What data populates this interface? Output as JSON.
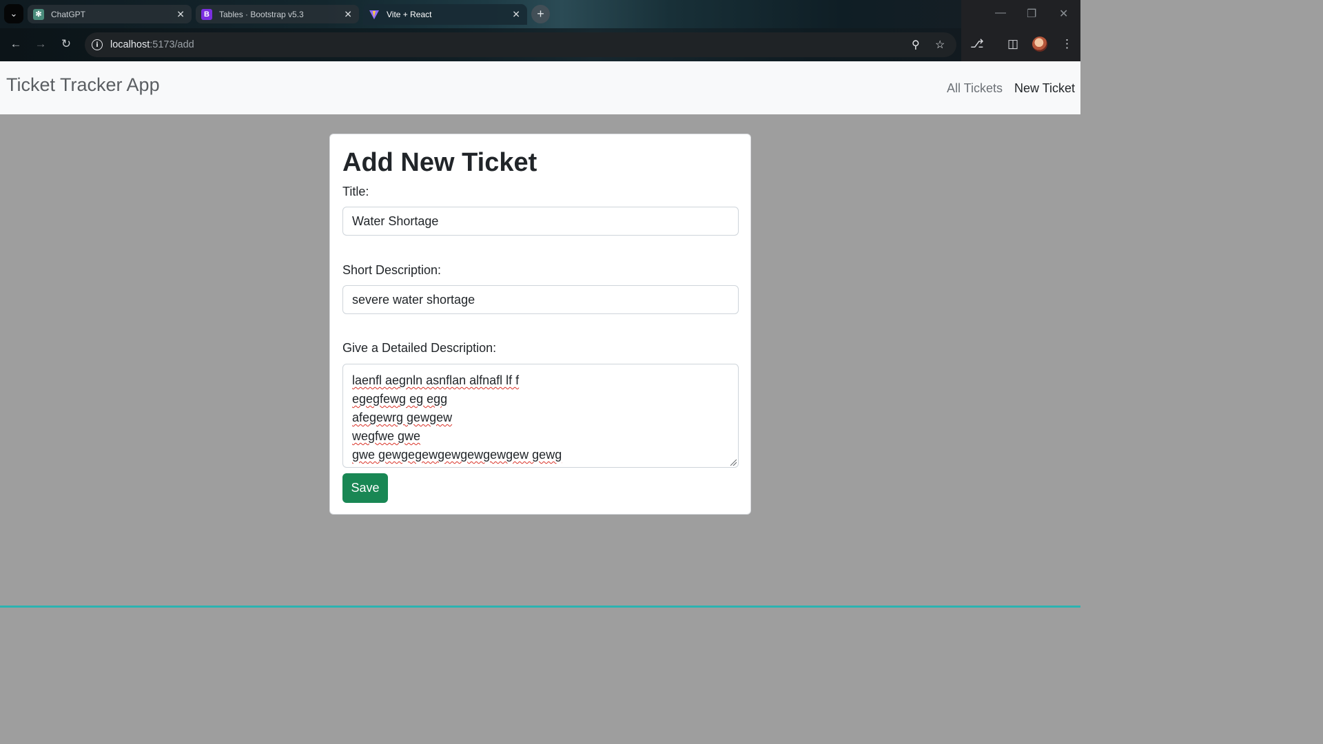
{
  "browser": {
    "tabs": [
      {
        "title": "ChatGPT",
        "icon": "chatgpt-icon",
        "active": false
      },
      {
        "title": "Tables · Bootstrap v5.3",
        "icon": "bootstrap-icon",
        "active": false
      },
      {
        "title": "Vite + React",
        "icon": "vite-icon",
        "active": true
      }
    ],
    "url_host": "localhost",
    "url_path": ":5173/add"
  },
  "app": {
    "brand": "Ticket Tracker App",
    "nav": {
      "all_tickets": "All Tickets",
      "new_ticket": "New Ticket"
    }
  },
  "form": {
    "heading": "Add New Ticket",
    "title_label": "Title:",
    "title_value": "Water Shortage",
    "short_desc_label": "Short Description:",
    "short_desc_value": "severe water shortage",
    "detail_label": "Give a Detailed Description:",
    "detail_lines": [
      "laenfl aegnln asnflan alfnafl lf f",
      "egegfewg eg egg",
      "afegewrg gewgew",
      "wegfwe gwe",
      "gwe gewgegewgewgewgewgew gewg"
    ],
    "save_label": "Save"
  },
  "colors": {
    "page_background": "#9e9e9e",
    "save_button": "#198754",
    "navbar_background": "#f8f9fa"
  }
}
